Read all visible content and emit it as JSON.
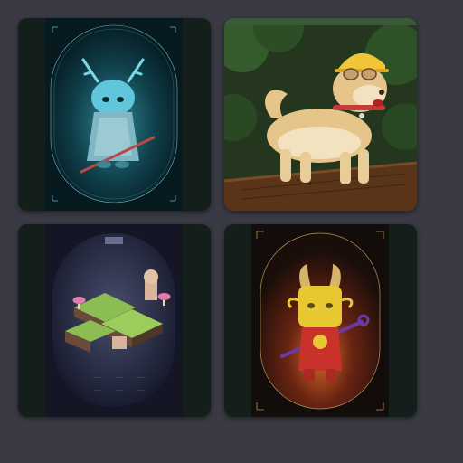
{
  "gallery": {
    "items": [
      {
        "name": "blue dragon samurai card"
      },
      {
        "name": "shiba dog with helmet"
      },
      {
        "name": "isometric island map card"
      },
      {
        "name": "yellow horned creature card"
      }
    ]
  },
  "colors": {
    "page_background": "#3a3a44",
    "tile_dark_green": "#141e1a",
    "card1_glow": "#1f6a78",
    "card4_glow": "#c0562a",
    "accent_gold": "#b8955a"
  }
}
